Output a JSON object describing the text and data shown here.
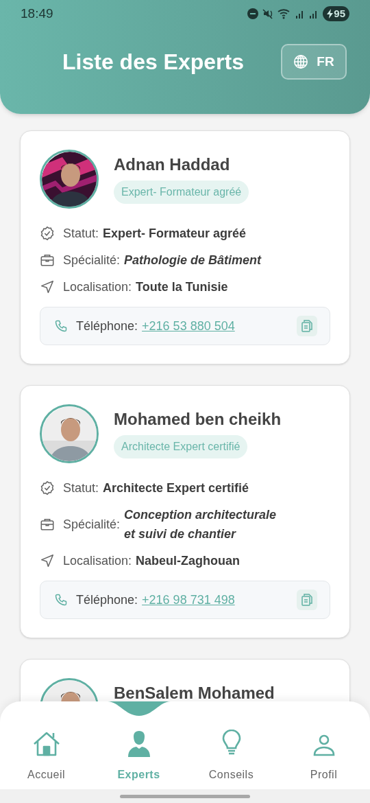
{
  "status_bar": {
    "time": "18:49",
    "battery": "95"
  },
  "header": {
    "title": "Liste des Experts",
    "language_button": "FR"
  },
  "experts": [
    {
      "name": "Adnan Haddad",
      "badge": "Expert- Formateur agréé",
      "details": [
        {
          "kind": "status",
          "label": "Statut:",
          "value": "Expert- Formateur agréé"
        },
        {
          "kind": "specialty",
          "label": "Spécialité:",
          "value": "Pathologie de Bâtiment"
        },
        {
          "kind": "location",
          "label": "Localisation:",
          "value": "Toute la Tunisie"
        }
      ],
      "phone_label": "Téléphone:",
      "phone": "+216 53 880 504"
    },
    {
      "name": "Mohamed ben cheikh",
      "badge": "Architecte Expert certifié",
      "details": [
        {
          "kind": "status",
          "label": "Statut:",
          "value": "Architecte Expert certifié"
        },
        {
          "kind": "specialty",
          "label": "Spécialité:",
          "value": "Conception architecturale et suivi de chantier"
        },
        {
          "kind": "location",
          "label": "Localisation:",
          "value": "Nabeul-Zaghouan"
        }
      ],
      "phone_label": "Téléphone:",
      "phone": "+216 98 731 498"
    },
    {
      "name": "BenSalem Mohamed"
    }
  ],
  "bottom_nav": [
    {
      "label": "Accueil",
      "selected": false
    },
    {
      "label": "Experts",
      "selected": true
    },
    {
      "label": "Conseils",
      "selected": false
    },
    {
      "label": "Profil",
      "selected": false
    }
  ]
}
